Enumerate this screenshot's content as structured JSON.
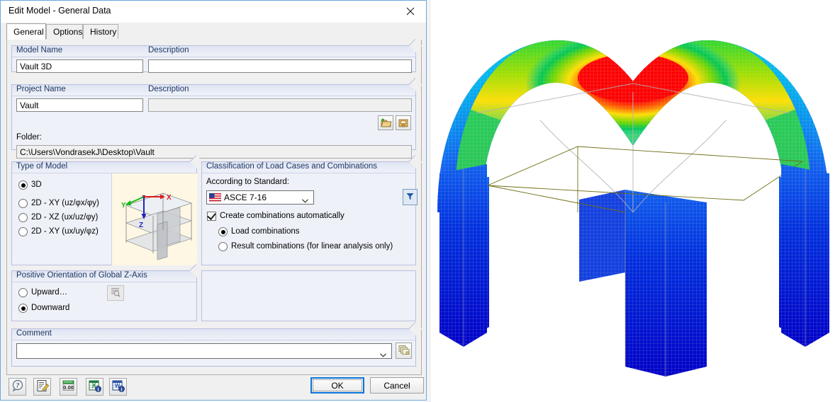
{
  "window": {
    "title": "Edit Model - General Data",
    "close_label": "✕"
  },
  "tabs": [
    {
      "label": "General",
      "active": true
    },
    {
      "label": "Options",
      "active": false
    },
    {
      "label": "History",
      "active": false
    }
  ],
  "general": {
    "model_name_label": "Model Name",
    "model_name_value": "Vault 3D",
    "model_description_label": "Description",
    "model_description_value": "",
    "project_name_label": "Project Name",
    "project_name_value": "Vault",
    "project_description_label": "Description",
    "project_description_value": "",
    "folder_label": "Folder:",
    "folder_value": "C:\\Users\\VondrasekJ\\Desktop\\Vault",
    "new_folder_icon": "new-folder-icon",
    "browse_folder_icon": "browse-folder-icon"
  },
  "type_of_model": {
    "title": "Type of Model",
    "options": [
      {
        "label": "3D",
        "selected": true
      },
      {
        "label": "2D - XY (uz/φx/φy)",
        "selected": false
      },
      {
        "label": "2D - XZ (ux/uz/φy)",
        "selected": false
      },
      {
        "label": "2D - XY (ux/uy/φz)",
        "selected": false
      }
    ],
    "thumbnail_axes": {
      "x": "X",
      "y": "Y",
      "z": "Z"
    },
    "thumbnail_colors": {
      "x": "#e01b1b",
      "y": "#14b814",
      "z": "#2222c8",
      "bg": "#fdf7e4"
    }
  },
  "classification": {
    "title": "Classification of Load Cases and Combinations",
    "standard_label": "According to Standard:",
    "standard_value": "ASCE 7-16",
    "standard_flag_icon": "us-flag-icon",
    "filter_icon": "filter-funnel-icon",
    "auto_combinations_label": "Create combinations automatically",
    "auto_combinations_checked": true,
    "combination_options": [
      {
        "label": "Load combinations",
        "selected": true
      },
      {
        "label": "Result combinations (for linear analysis only)",
        "selected": false
      }
    ]
  },
  "z_axis": {
    "title": "Positive Orientation of Global Z-Axis",
    "options": [
      {
        "label": "Upward…",
        "selected": false
      },
      {
        "label": "Downward",
        "selected": true
      }
    ],
    "preview_icon": "preview-list-icon",
    "preview_enabled": false
  },
  "comment": {
    "title": "Comment",
    "value": "",
    "dropdown_icon": "chevron-down-icon",
    "picker_icon": "comment-library-icon"
  },
  "command_bar": {
    "tools": [
      {
        "name": "help-icon",
        "glyph": "?",
        "tooltip": "Help"
      },
      {
        "name": "edit-note-icon",
        "glyph": "✎",
        "tooltip": "Edit"
      },
      {
        "name": "units-decimal-icon",
        "glyph": "0.00",
        "tooltip": "Units and Decimal Places"
      },
      {
        "name": "export-excel-icon",
        "glyph": "X",
        "tooltip": "Export to MS Excel"
      },
      {
        "name": "export-word-icon",
        "glyph": "W",
        "tooltip": "Export to MS Word"
      }
    ],
    "ok_label": "OK",
    "cancel_label": "Cancel"
  },
  "viewport": {
    "name": "3d-fea-result-view",
    "model": "vault-groin-shell",
    "colors": {
      "max": "#ff0000",
      "high": "#ff8000",
      "mid_high": "#ffee00",
      "mid": "#00d020",
      "mid_low": "#00d8d8",
      "low": "#1060f0",
      "min": "#0000d0",
      "outline": "#7a7a2e",
      "mesh": "#b8b8b8"
    }
  }
}
